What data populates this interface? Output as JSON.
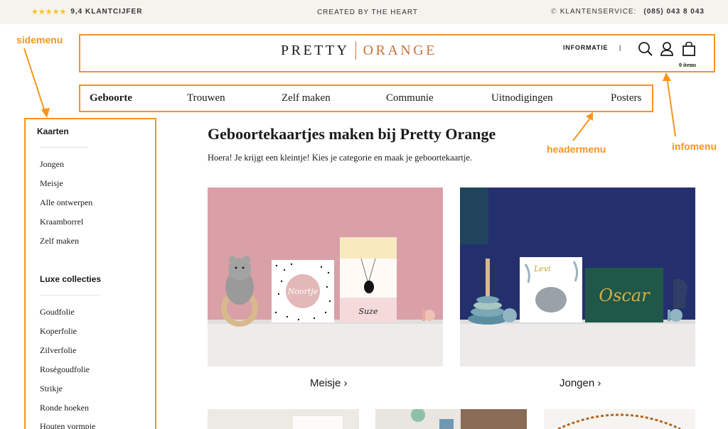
{
  "topbar": {
    "stars": "★★★★★",
    "rating": "9,4 KLANTCIJFER",
    "tagline": "CREATED BY THE HEART",
    "service_label": "KLANTENSERVICE:",
    "phone": "(085) 043 8 043"
  },
  "annotations": {
    "sidemenu": "sidemenu",
    "headermenu": "headermenu",
    "infomenu": "infomenu",
    "color": "#f7941d"
  },
  "header": {
    "logo_left": "PRETTY",
    "logo_right": "ORANGE",
    "info_label": "INFORMATIE",
    "divider": "|",
    "cart_count": "0 items",
    "icons": [
      "search-icon",
      "user-icon",
      "bag-icon"
    ]
  },
  "nav": {
    "items": [
      {
        "label": "Geboorte",
        "active": true
      },
      {
        "label": "Trouwen"
      },
      {
        "label": "Zelf maken"
      },
      {
        "label": "Communie"
      },
      {
        "label": "Uitnodigingen"
      },
      {
        "label": "Posters"
      }
    ]
  },
  "sidebar": {
    "section1": {
      "heading": "Kaarten",
      "links": [
        "Jongen",
        "Meisje",
        "Alle ontwerpen",
        "Kraamborrel",
        "Zelf maken"
      ]
    },
    "section2": {
      "heading": "Luxe collecties",
      "links": [
        "Goudfolie",
        "Koperfolie",
        "Zilverfolie",
        "Roségoudfolie",
        "Strikje",
        "Ronde hoeken",
        "Houten vormpje"
      ]
    }
  },
  "main": {
    "title": "Geboortekaartjes maken bij Pretty Orange",
    "intro": "Hoera! Je krijgt een kleintje! Kies je categorie en maak je geboortekaartje.",
    "cards": [
      {
        "label": "Meisje ›",
        "name_on_card_1": "Noortje",
        "name_on_card_2": "Suze"
      },
      {
        "label": "Jongen ›",
        "name_on_card_1": "Levi",
        "name_on_card_2": "Oscar"
      }
    ]
  },
  "colors": {
    "accent": "#f7941d",
    "brand_orange": "#c8733a",
    "topbar_bg": "#f6f2ee",
    "pink_bg": "#d9a0a8",
    "navy_bg": "#24306e"
  }
}
